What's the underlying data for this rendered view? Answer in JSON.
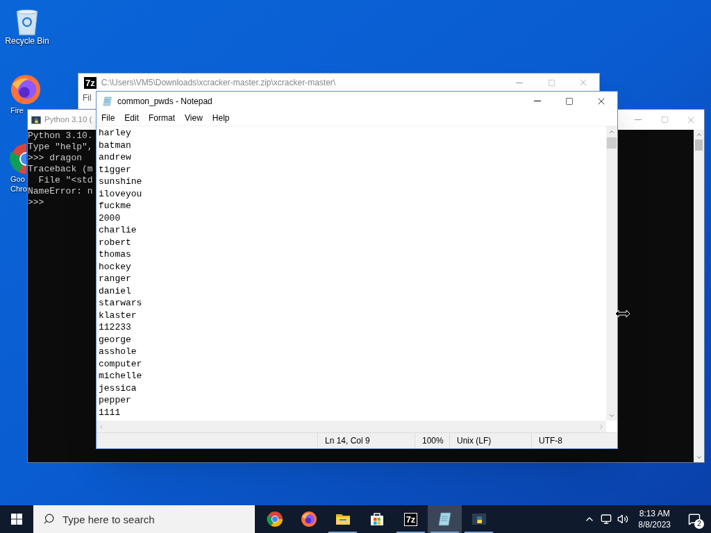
{
  "desktop_icons": [
    {
      "kind": "recycle",
      "label_lines": [
        "Recycle Bin"
      ]
    },
    {
      "kind": "firefox",
      "label_lines": [
        "Fire"
      ]
    },
    {
      "kind": "chrome",
      "label_lines": [
        "Goo",
        "Chro"
      ]
    }
  ],
  "archive_window": {
    "icon_text": "7z",
    "title": "C:\\Users\\VM5\\Downloads\\xcracker-master.zip\\xcracker-master\\",
    "active": false,
    "menu": [
      "Fil"
    ]
  },
  "console_window": {
    "title": "Python 3.10 (",
    "active": false,
    "lines": [
      "Python 3.10.",
      "Type \"help\",",
      ">>> dragon",
      "Traceback (m",
      "  File \"<std",
      "NameError: n",
      ">>>"
    ]
  },
  "notepad": {
    "title": "common_pwds - Notepad",
    "active": true,
    "menu": [
      "File",
      "Edit",
      "Format",
      "View",
      "Help"
    ],
    "lines": [
      "harley",
      "batman",
      "andrew",
      "tigger",
      "sunshine",
      "iloveyou",
      "fuckme",
      "2000",
      "charlie",
      "robert",
      "thomas",
      "hockey",
      "ranger",
      "daniel",
      "starwars",
      "klaster",
      "112233",
      "george",
      "asshole",
      "computer",
      "michelle",
      "jessica",
      "pepper",
      "1111"
    ],
    "status": [
      "Ln 14, Col 9",
      "100%",
      "Unix (LF)",
      "UTF-8"
    ]
  },
  "taskbar": {
    "search": {
      "placeholder": "Type here to search"
    },
    "apps": [
      {
        "kind": "chrome",
        "running": false,
        "selected": false
      },
      {
        "kind": "firefox",
        "running": false,
        "selected": false
      },
      {
        "kind": "explorer",
        "running": true,
        "selected": false
      },
      {
        "kind": "store",
        "running": false,
        "selected": false
      },
      {
        "kind": "archiver",
        "label": "7z",
        "running": true,
        "selected": false
      },
      {
        "kind": "notepad",
        "running": true,
        "selected": true
      },
      {
        "kind": "python",
        "running": true,
        "selected": false
      }
    ],
    "time": "8:13 AM",
    "date": "8/8/2023",
    "notifications": "2"
  }
}
